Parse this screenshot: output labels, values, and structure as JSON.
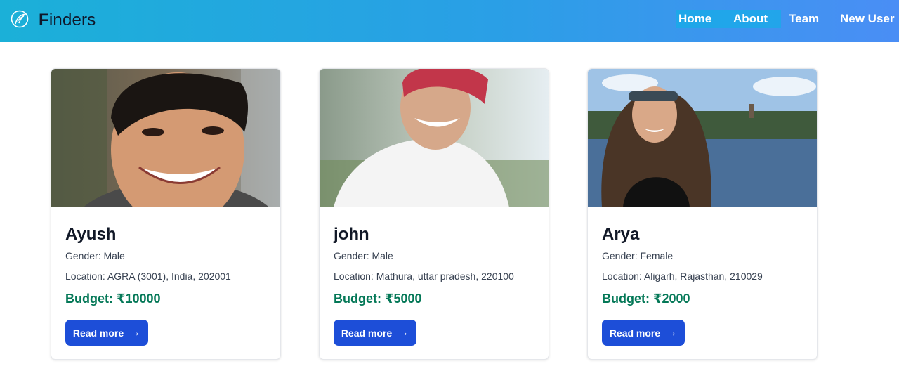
{
  "header": {
    "brand_first": "F",
    "brand_rest": "inders",
    "logo_icon": "feather-circle-icon",
    "nav": [
      {
        "label": "Home"
      },
      {
        "label": "About"
      },
      {
        "label": "Team"
      },
      {
        "label": "New User"
      }
    ]
  },
  "cards": [
    {
      "name": "Ayush",
      "gender": "Gender: Male",
      "location": "Location: AGRA (3001), India, 202001",
      "budget": "Budget: ₹10000",
      "button_label": "Read more",
      "button_icon": "arrow-right-icon"
    },
    {
      "name": "john",
      "gender": "Gender: Male",
      "location": "Location: Mathura, uttar pradesh, 220100",
      "budget": "Budget: ₹5000",
      "button_label": "Read more",
      "button_icon": "arrow-right-icon"
    },
    {
      "name": "Arya",
      "gender": "Gender: Female",
      "location": "Location: Aligarh, Rajasthan, 210029",
      "budget": "Budget: ₹2000",
      "button_label": "Read more",
      "button_icon": "arrow-right-icon"
    }
  ],
  "colors": {
    "header_gradient_start": "#1bb0d8",
    "header_gradient_end": "#4a8ef5",
    "button": "#1d4ed8",
    "budget": "#047857"
  }
}
